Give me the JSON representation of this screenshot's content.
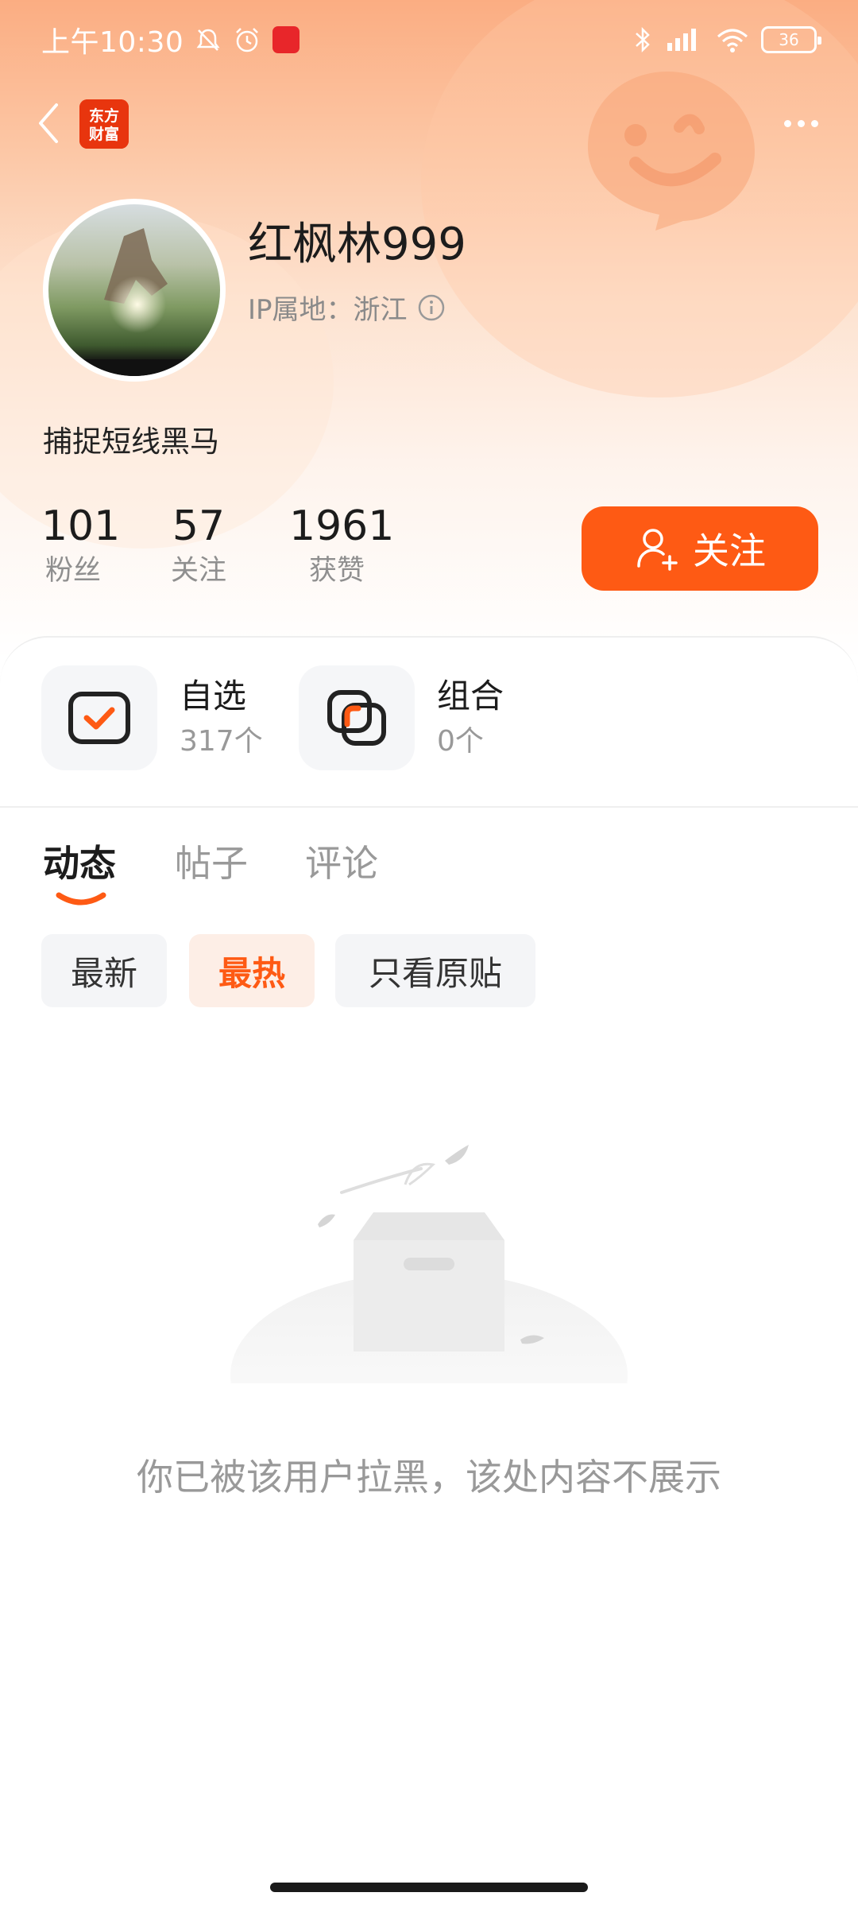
{
  "status_bar": {
    "time": "上午10:30",
    "battery": "36"
  },
  "brand": {
    "logo_text": "东方\n财富"
  },
  "profile": {
    "username": "红枫林999",
    "ip_location": "IP属地：浙江",
    "bio": "捕捉短线黑马"
  },
  "stats": [
    {
      "value": "101",
      "label": "粉丝"
    },
    {
      "value": "57",
      "label": "关注"
    },
    {
      "value": "1961",
      "label": "获赞"
    }
  ],
  "follow_button": {
    "label": "关注"
  },
  "quick_links": [
    {
      "title": "自选",
      "count": "317个",
      "icon": "watchlist-check-icon"
    },
    {
      "title": "组合",
      "count": "0个",
      "icon": "portfolio-icon"
    }
  ],
  "tabs": [
    {
      "label": "动态",
      "active": true
    },
    {
      "label": "帖子",
      "active": false
    },
    {
      "label": "评论",
      "active": false
    }
  ],
  "filters": [
    {
      "label": "最新",
      "active": false
    },
    {
      "label": "最热",
      "active": true
    },
    {
      "label": "只看原贴",
      "active": false
    }
  ],
  "empty_state": {
    "message": "你已被该用户拉黑，该处内容不展示"
  },
  "colors": {
    "accent": "#fe5a14",
    "header_gradient_top": "#fbad82"
  }
}
